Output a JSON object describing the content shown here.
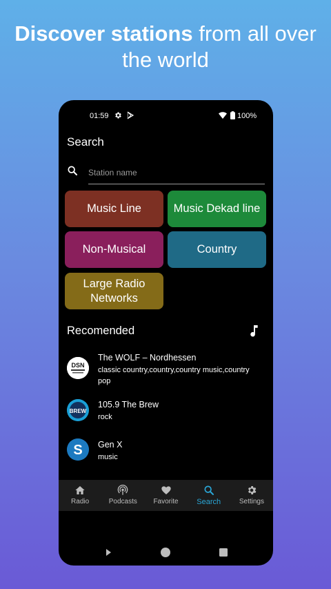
{
  "promo": {
    "headline_bold": "Discover stations",
    "headline_rest": " from all over the world"
  },
  "status_bar": {
    "time": "01:59",
    "battery": "100%",
    "icons": [
      "gear-icon",
      "play-store-icon",
      "wifi-icon",
      "battery-icon"
    ]
  },
  "screen": {
    "title": "Search"
  },
  "search": {
    "placeholder": "Station name",
    "value": ""
  },
  "categories": [
    {
      "label": "Music Line",
      "color": "#7d3023"
    },
    {
      "label": "Music Dekad line",
      "color": "#1d8a3a"
    },
    {
      "label": "Non-Musical",
      "color": "#8a1f5c"
    },
    {
      "label": "Country",
      "color": "#1f6a86"
    },
    {
      "label": "Large Radio Networks",
      "color": "#846b18"
    }
  ],
  "recommended": {
    "title": "Recomended",
    "items": [
      {
        "name": "The WOLF – Nordhessen",
        "tags": "classic country,country,country music,country pop",
        "logo": "DSN"
      },
      {
        "name": "105.9 The Brew",
        "tags": "rock",
        "logo": "BREW"
      },
      {
        "name": "Gen X",
        "tags": "music",
        "logo": "S"
      }
    ]
  },
  "bottom_nav": [
    {
      "label": "Radio",
      "icon": "home-icon",
      "active": false
    },
    {
      "label": "Podcasts",
      "icon": "podcast-icon",
      "active": false
    },
    {
      "label": "Favorite",
      "icon": "heart-icon",
      "active": false
    },
    {
      "label": "Search",
      "icon": "search-icon",
      "active": true
    },
    {
      "label": "Settings",
      "icon": "gear-icon",
      "active": false
    }
  ],
  "colors": {
    "accent": "#2aa6d6",
    "background": "#000000",
    "nav_background": "#1c1c1c"
  }
}
